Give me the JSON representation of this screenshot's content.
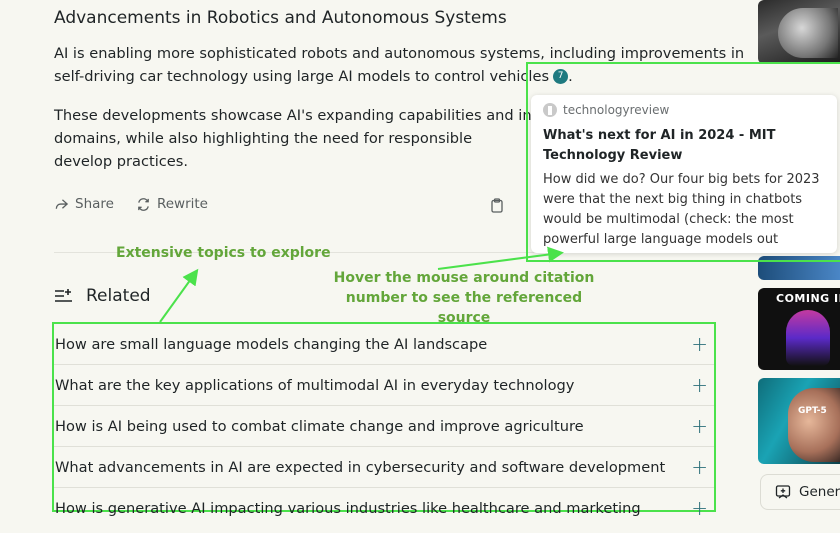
{
  "answer": {
    "title": "Advancements in Robotics and Autonomous Systems",
    "para1": "AI is enabling more sophisticated robots and autonomous systems, including improvements in self-driving car technology using large AI models to control vehicles",
    "para1_end": ".",
    "citation_number": "7",
    "para2": "These developments showcase AI's expanding capabilities and in domains, while also highlighting the need for responsible develop practices."
  },
  "actions": {
    "share_label": "Share",
    "rewrite_label": "Rewrite"
  },
  "related": {
    "heading": "Related",
    "items": [
      "How are small language models changing the AI landscape",
      "What are the key applications of multimodal AI in everyday technology",
      "How is AI being used to combat climate change and improve agriculture",
      "What advancements in AI are expected in cybersecurity and software development",
      "How is generative AI impacting various industries like healthcare and marketing"
    ],
    "plus_glyph": "+"
  },
  "annotations": {
    "topics": "Extensive topics to explore",
    "hover": "Hover the mouse around citation number to see the referenced source"
  },
  "citation_popup": {
    "source": "technologyreview",
    "title": "What's next for AI in 2024 - MIT Technology Review",
    "snippet": "How did we do? Our four big bets for 2023 were that the next big thing in chatbots would be multimodal (check: the most powerful large language models out there,..."
  },
  "sidebar": {
    "thumb3_caption": "COMING IN",
    "thumb4_caption": "GPT-5",
    "generate_label": "Generate"
  },
  "colors": {
    "accent": "#1f7a80",
    "annotation_green": "#63a63a",
    "highlight_green": "#4be24b"
  }
}
